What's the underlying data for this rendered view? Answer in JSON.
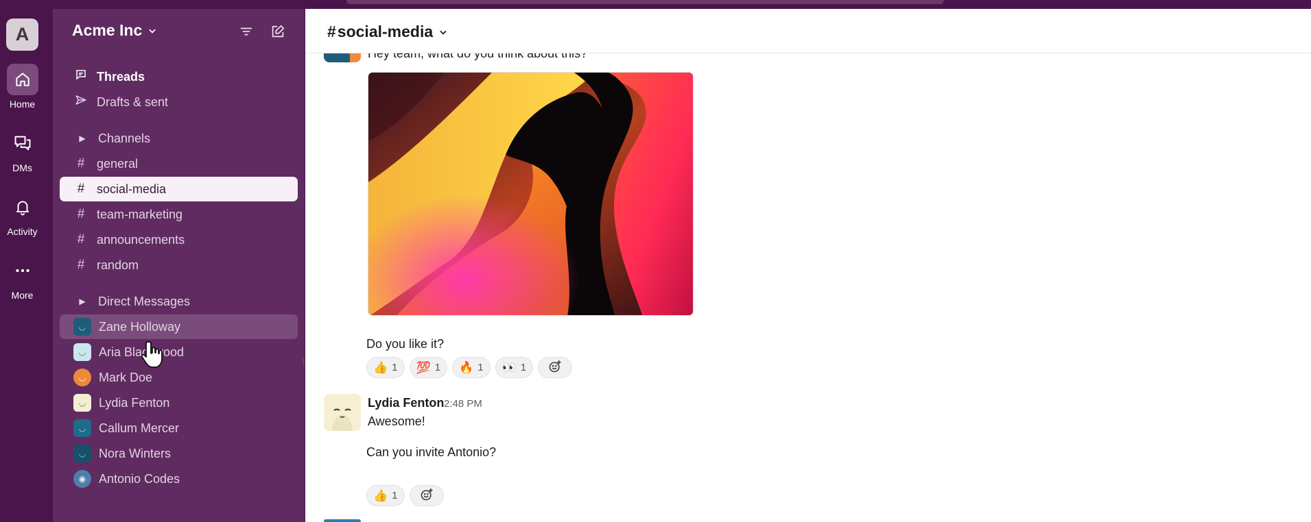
{
  "workspace": {
    "initial": "A",
    "name": "Acme Inc"
  },
  "rail": [
    {
      "label": "Home",
      "icon": "home-icon",
      "active": true
    },
    {
      "label": "DMs",
      "icon": "dms-icon"
    },
    {
      "label": "Activity",
      "icon": "bell-icon"
    },
    {
      "label": "More",
      "icon": "more-icon"
    }
  ],
  "sidebar": {
    "threads": "Threads",
    "drafts": "Drafts & sent",
    "channels_header": "Channels",
    "channels": [
      "general",
      "social-media",
      "team-marketing",
      "announcements",
      "random"
    ],
    "active_channel": "social-media",
    "dm_header": "Direct Messages",
    "dms": [
      "Zane Holloway",
      "Aria Blackwood",
      "Mark Doe",
      "Lydia Fenton",
      "Callum Mercer",
      "Nora Winters",
      "Antonio Codes"
    ]
  },
  "channel": {
    "hash": "#",
    "name": "social-media"
  },
  "messages": {
    "partial_top": "Hey team, what do you think about this?",
    "question": "Do you like it?",
    "reactions1": [
      {
        "emoji": "👍",
        "count": "1"
      },
      {
        "emoji": "💯",
        "count": "1"
      },
      {
        "emoji": "🔥",
        "count": "1"
      },
      {
        "emoji": "👀",
        "count": "1"
      }
    ],
    "author": "Lydia Fenton",
    "time": "2:48 PM",
    "reply1": "Awesome!",
    "reply2": "Can you invite Antonio?",
    "reactions2": [
      {
        "emoji": "👍",
        "count": "1"
      }
    ]
  },
  "colors": {
    "aubergine": "#4a154b",
    "sidebar": "#5f2b60",
    "active_row": "#f7f1f7"
  }
}
